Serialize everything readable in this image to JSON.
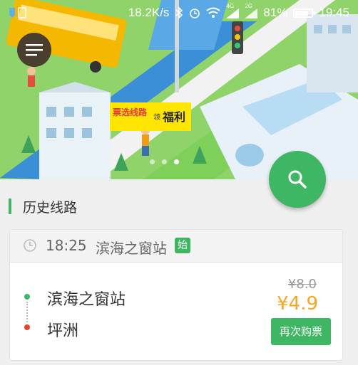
{
  "status_bar": {
    "network_speed": "18.2K/s",
    "signal_1": "4G",
    "signal_2": "2G",
    "battery": "81%",
    "battery_level": 0.81,
    "time": "19:45"
  },
  "banner": {
    "promo_main": "票选线路",
    "promo_mid": "领",
    "promo_end": "福利",
    "page_count": 3,
    "active_index": 2
  },
  "history": {
    "section_title": "历史线路",
    "trips": [
      {
        "time": "18:25",
        "station": "滨海之窗站",
        "badge": "始",
        "from": "滨海之窗站",
        "to": "坪洲",
        "old_price": "¥8.0",
        "price": "¥4.9",
        "rebuy_label": "再次购票"
      }
    ]
  },
  "colors": {
    "accent": "#3fb664",
    "price": "#f5a623",
    "destination": "#e0452c"
  },
  "icons": {
    "menu": "menu-icon",
    "search": "search-icon",
    "clock": "clock-icon"
  }
}
